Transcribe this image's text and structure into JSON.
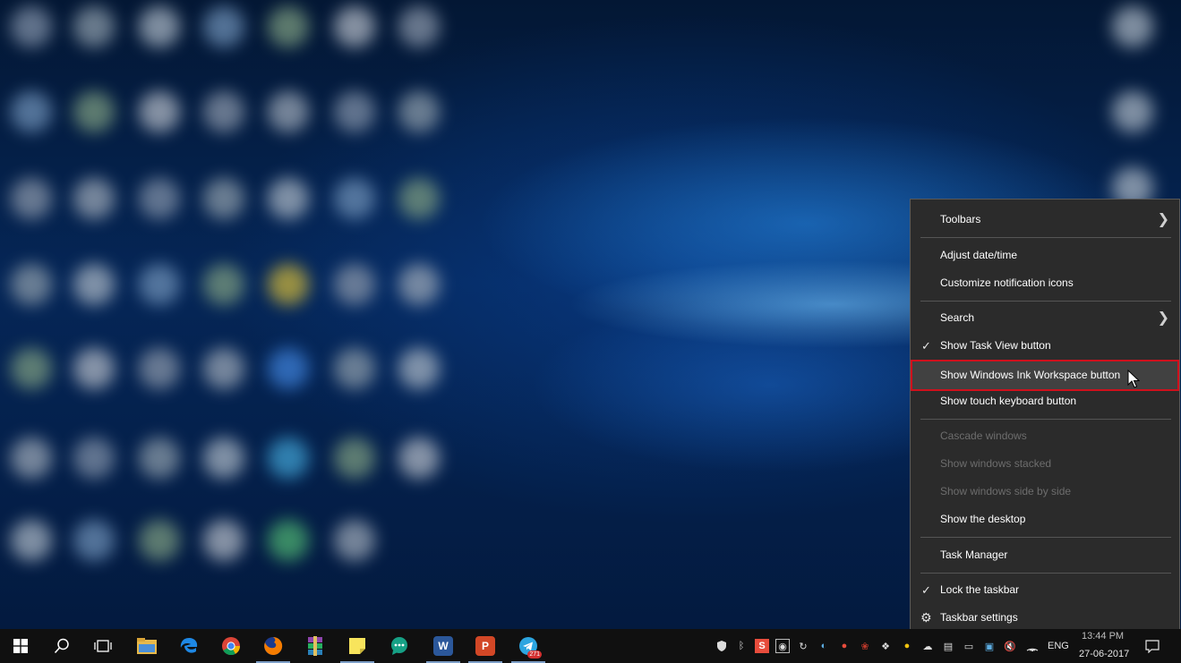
{
  "context_menu": {
    "items": [
      {
        "label": "Toolbars",
        "submenu": true
      },
      {
        "label": "Adjust date/time"
      },
      {
        "label": "Customize notification icons"
      },
      {
        "label": "Search",
        "submenu": true
      },
      {
        "label": "Show Task View button",
        "checked": true
      },
      {
        "label": "Show Windows Ink Workspace button",
        "highlighted": true
      },
      {
        "label": "Show touch keyboard button"
      },
      {
        "label": "Cascade windows",
        "disabled": true
      },
      {
        "label": "Show windows stacked",
        "disabled": true
      },
      {
        "label": "Show windows side by side",
        "disabled": true
      },
      {
        "label": "Show the desktop"
      },
      {
        "label": "Task Manager"
      },
      {
        "label": "Lock the taskbar",
        "checked": true
      },
      {
        "label": "Taskbar settings",
        "icon": "gear-icon"
      }
    ],
    "highlight_color": "#d0101c"
  },
  "taskbar": {
    "apps": [
      {
        "name": "file-explorer-icon"
      },
      {
        "name": "edge-icon"
      },
      {
        "name": "chrome-icon"
      },
      {
        "name": "firefox-icon"
      },
      {
        "name": "winrar-icon"
      },
      {
        "name": "sticky-notes-icon"
      },
      {
        "name": "chat-icon"
      },
      {
        "name": "word-icon",
        "letter": "W"
      },
      {
        "name": "powerpoint-icon",
        "letter": "P"
      },
      {
        "name": "telegram-icon",
        "badge": "271"
      }
    ],
    "tray": {
      "language": "ENG",
      "time": "13:44 PM",
      "date": "27-06-2017"
    }
  }
}
